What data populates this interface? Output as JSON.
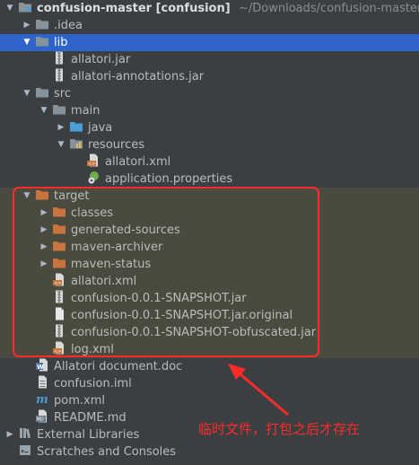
{
  "tree": [
    {
      "depth": 0,
      "arrow": "down",
      "icon": "module-folder",
      "label": "confusion-master [confusion]",
      "bold": true,
      "suffix": " ~/Downloads/confusion-master",
      "state": "normal"
    },
    {
      "depth": 1,
      "arrow": "right",
      "icon": "folder",
      "label": ".idea",
      "state": "normal"
    },
    {
      "depth": 1,
      "arrow": "down",
      "icon": "folder",
      "label": "lib",
      "state": "selected"
    },
    {
      "depth": 2,
      "arrow": "",
      "icon": "jar",
      "label": "allatori.jar",
      "state": "normal"
    },
    {
      "depth": 2,
      "arrow": "",
      "icon": "jar",
      "label": "allatori-annotations.jar",
      "state": "normal"
    },
    {
      "depth": 1,
      "arrow": "down",
      "icon": "folder",
      "label": "src",
      "state": "normal"
    },
    {
      "depth": 2,
      "arrow": "down",
      "icon": "folder",
      "label": "main",
      "state": "normal"
    },
    {
      "depth": 3,
      "arrow": "right",
      "icon": "source-folder",
      "label": "java",
      "state": "normal"
    },
    {
      "depth": 3,
      "arrow": "down",
      "icon": "resources-folder",
      "label": "resources",
      "state": "normal"
    },
    {
      "depth": 4,
      "arrow": "",
      "icon": "xml",
      "label": "allatori.xml",
      "state": "normal"
    },
    {
      "depth": 4,
      "arrow": "",
      "icon": "properties",
      "label": "application.properties",
      "state": "normal"
    },
    {
      "depth": 1,
      "arrow": "down",
      "icon": "excluded-folder",
      "label": "target",
      "state": "excluded"
    },
    {
      "depth": 2,
      "arrow": "right",
      "icon": "excluded-folder",
      "label": "classes",
      "state": "excluded"
    },
    {
      "depth": 2,
      "arrow": "right",
      "icon": "excluded-folder",
      "label": "generated-sources",
      "state": "excluded"
    },
    {
      "depth": 2,
      "arrow": "right",
      "icon": "excluded-folder",
      "label": "maven-archiver",
      "state": "excluded"
    },
    {
      "depth": 2,
      "arrow": "right",
      "icon": "excluded-folder",
      "label": "maven-status",
      "state": "excluded"
    },
    {
      "depth": 2,
      "arrow": "",
      "icon": "xml",
      "label": "allatori.xml",
      "state": "excluded"
    },
    {
      "depth": 2,
      "arrow": "",
      "icon": "jar",
      "label": "confusion-0.0.1-SNAPSHOT.jar",
      "state": "excluded"
    },
    {
      "depth": 2,
      "arrow": "",
      "icon": "file",
      "label": "confusion-0.0.1-SNAPSHOT.jar.original",
      "state": "excluded"
    },
    {
      "depth": 2,
      "arrow": "",
      "icon": "jar",
      "label": "confusion-0.0.1-SNAPSHOT-obfuscated.jar",
      "state": "excluded"
    },
    {
      "depth": 2,
      "arrow": "",
      "icon": "xml",
      "label": "log.xml",
      "state": "excluded"
    },
    {
      "depth": 1,
      "arrow": "",
      "icon": "doc",
      "label": "Allatori document.doc",
      "state": "normal"
    },
    {
      "depth": 1,
      "arrow": "",
      "icon": "iml",
      "label": "confusion.iml",
      "state": "normal"
    },
    {
      "depth": 1,
      "arrow": "",
      "icon": "maven",
      "label": "pom.xml",
      "state": "normal"
    },
    {
      "depth": 1,
      "arrow": "",
      "icon": "markdown",
      "label": "README.md",
      "state": "normal"
    },
    {
      "depth": 0,
      "arrow": "right",
      "icon": "libraries",
      "label": "External Libraries",
      "state": "normal"
    },
    {
      "depth": 0,
      "arrow": "",
      "icon": "scratches",
      "label": "Scratches and Consoles",
      "state": "normal"
    }
  ],
  "annotation": {
    "text": "临时文件，打包之后才存在",
    "color": "#ff2a2a"
  },
  "colors": {
    "background": "#3c3f41",
    "selection": "#2f65ca",
    "excluded_row": "#4b4a3e",
    "folder": "#87939a",
    "excluded_folder": "#c8743f",
    "source_folder": "#4a9fd6"
  }
}
